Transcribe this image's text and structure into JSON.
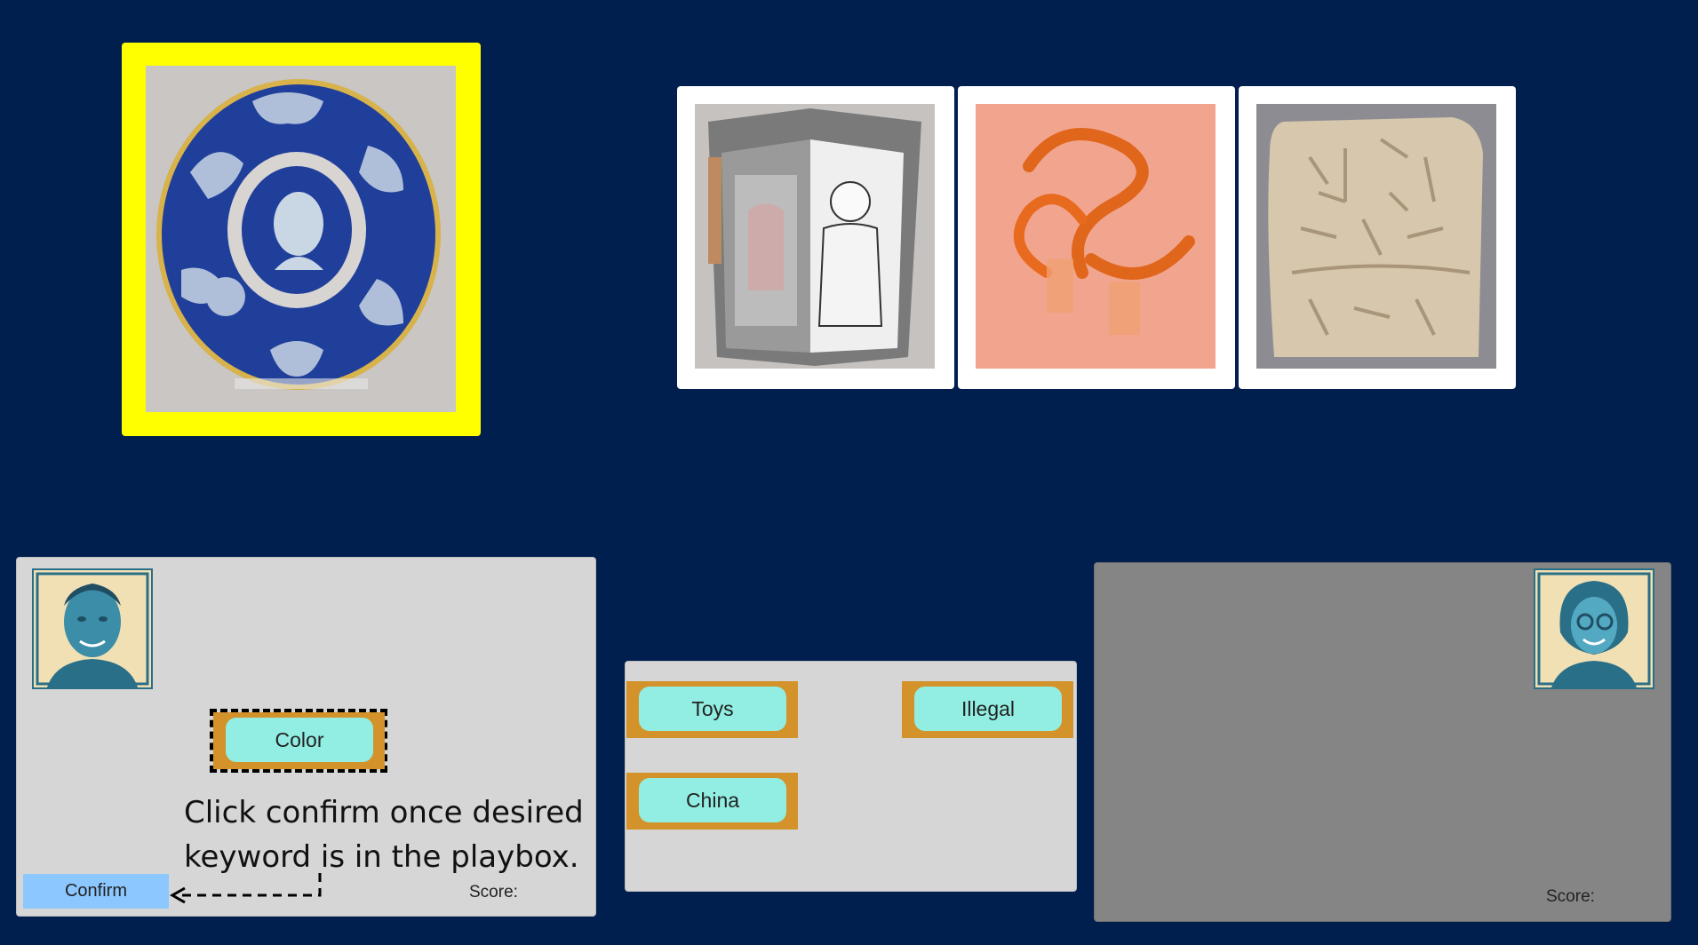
{
  "target_artwork": {
    "icon": "maiolica-plate-icon"
  },
  "candidates": [
    {
      "icon": "pop-up-book-icon"
    },
    {
      "icon": "orange-glass-sculpture-icon"
    },
    {
      "icon": "clay-tablet-icon"
    }
  ],
  "player_left": {
    "avatar_icon": "man-portrait-icon",
    "played_keyword": "Color",
    "instruction": "Click confirm once desired keyword is in the playbox.",
    "confirm_label": "Confirm",
    "score_label": "Score:"
  },
  "keyword_pool": {
    "keywords": [
      "Toys",
      "Illegal",
      "China"
    ]
  },
  "player_right": {
    "avatar_icon": "woman-portrait-icon",
    "score_label": "Score:"
  },
  "colors": {
    "background": "#001f4f",
    "highlight": "#ffff00",
    "chip_border": "#d3922a",
    "chip_fill": "#92eee2",
    "confirm": "#8cc7ff"
  }
}
